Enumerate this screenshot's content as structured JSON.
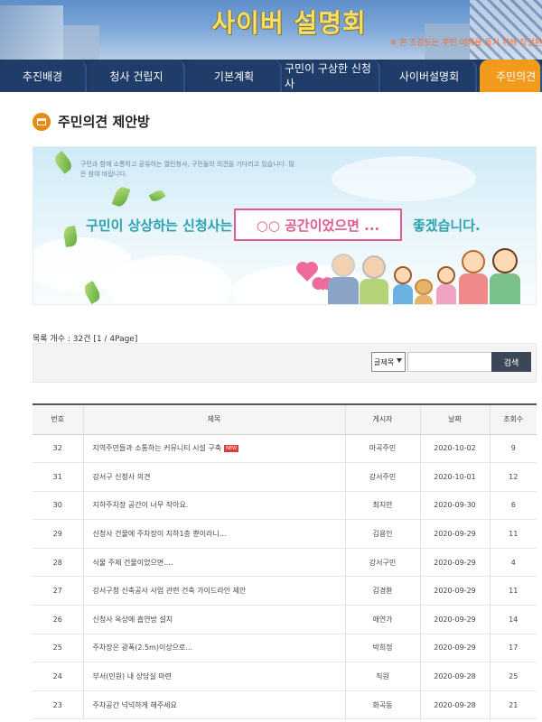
{
  "header": {
    "title": "사이버 설명회",
    "notice": "※ 본 조감도는 주민 이해를 돕기 위해 작성된"
  },
  "nav": {
    "tabs": [
      {
        "label": "추진배경"
      },
      {
        "label": "청사 건립지"
      },
      {
        "label": "기본계획"
      },
      {
        "label": "구민이 구상한 신청사"
      },
      {
        "label": "사이버설명회"
      },
      {
        "label": "주민의견 제안"
      }
    ],
    "active_index": 5
  },
  "section": {
    "title": "주민의견 제안방",
    "icon": "building-icon"
  },
  "promo": {
    "small_text": "구민과 함께 소통하고 공유하는 열린청사, 구민들의 의견을 기다리고 있습니다. 많은 참여 바랍니다.",
    "main_text": "구민이 상상하는 신청사는",
    "box_text": "○○ 공간이었으면 ...",
    "tail_text": "좋겠습니다."
  },
  "list": {
    "count_text": "목록 개수 : 32건 [1 / 4Page]"
  },
  "search": {
    "select_value": "글제목",
    "input_value": "",
    "button_label": "검색"
  },
  "table": {
    "headers": [
      "번호",
      "제목",
      "게시자",
      "날짜",
      "조회수"
    ],
    "rows": [
      {
        "no": "32",
        "title": "지역주민들과 소통하는 커뮤니티 시설 구축",
        "author": "마곡주민",
        "date": "2020-10-02",
        "views": "9",
        "new": "NEW"
      },
      {
        "no": "31",
        "title": "강서구 신청사 의견",
        "author": "강서주민",
        "date": "2020-10-01",
        "views": "12"
      },
      {
        "no": "30",
        "title": "지하주차장 공간이 너무 작아요.",
        "author": "최지만",
        "date": "2020-09-30",
        "views": "6"
      },
      {
        "no": "29",
        "title": "신청사 건물에 주차장이 지하1층 뿐이라니...",
        "author": "김용인",
        "date": "2020-09-29",
        "views": "11"
      },
      {
        "no": "28",
        "title": "식물 주제 건물이었으면....",
        "author": "강서구민",
        "date": "2020-09-29",
        "views": "4"
      },
      {
        "no": "27",
        "title": "강서구청 신축공사 사업 관련 건축 가이드라인 제안",
        "author": "김경환",
        "date": "2020-09-29",
        "views": "11"
      },
      {
        "no": "26",
        "title": "신청사 옥상에 흡연방 설치",
        "author": "애연가",
        "date": "2020-09-29",
        "views": "14"
      },
      {
        "no": "25",
        "title": "주차장은 광폭(2.5m)이상으로...",
        "author": "박희정",
        "date": "2020-09-29",
        "views": "17"
      },
      {
        "no": "24",
        "title": "부서(민원) 내 상담실 마련",
        "author": "직원",
        "date": "2020-09-28",
        "views": "25"
      },
      {
        "no": "23",
        "title": "주차공간 넉넉하게 해주세요",
        "author": "화곡동",
        "date": "2020-09-28",
        "views": "21"
      }
    ]
  },
  "colors": {
    "nav_bg": "#1f3d68",
    "nav_active": "#f29a1c",
    "title_gold": "#f7e06a",
    "promo_teal": "#2aa2b0",
    "promo_pink": "#e05a8c",
    "search_button": "#3c4656"
  }
}
